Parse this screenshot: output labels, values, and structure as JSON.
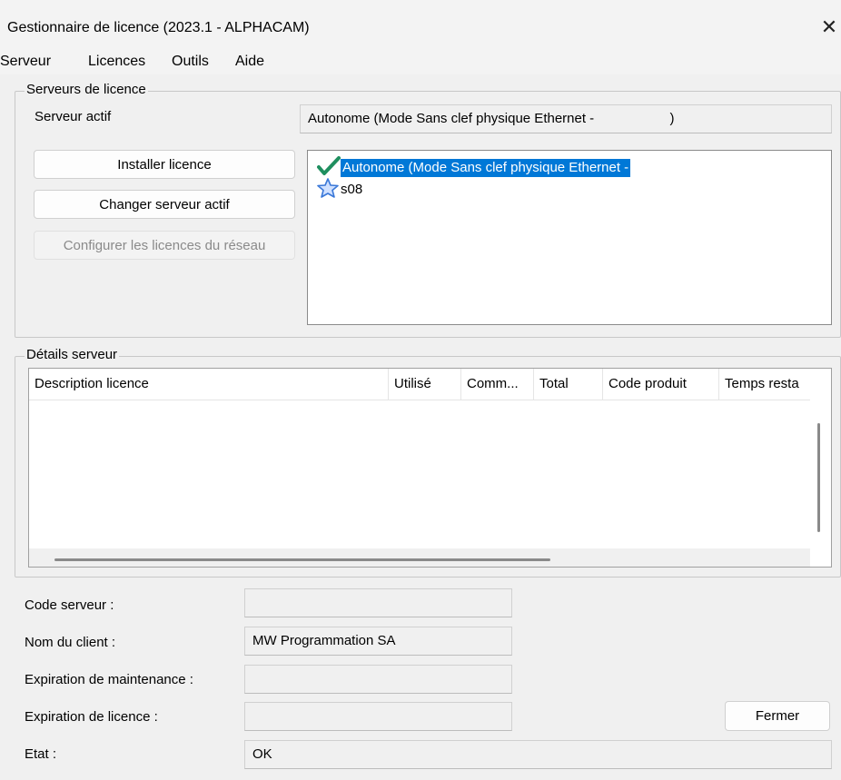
{
  "window": {
    "title": "Gestionnaire de licence (2023.1 - ALPHACAM)",
    "close_glyph": "✕"
  },
  "menu": [
    "Serveur",
    "Licences",
    "Outils",
    "Aide"
  ],
  "license_servers": {
    "group_title": "Serveurs de licence",
    "active_server_label": "Serveur actif",
    "active_server_value": "Autonome (Mode Sans clef physique Ethernet -                    )",
    "buttons": {
      "install": "Installer licence",
      "change_active": "Changer serveur actif",
      "configure_network": "Configurer les licences du réseau"
    },
    "list": [
      {
        "label": "Autonome (Mode Sans clef physique Ethernet -",
        "icon": "checkmark-icon",
        "selected": true
      },
      {
        "label": "s08",
        "icon": "star-icon",
        "selected": false
      }
    ]
  },
  "server_details": {
    "group_title": "Détails serveur",
    "columns": [
      "Description licence",
      "Utilisé",
      "Comm...",
      "Total",
      "Code produit",
      "Temps resta"
    ],
    "rows": []
  },
  "fields": {
    "server_code": {
      "label": "Code serveur :",
      "value": ""
    },
    "client_name": {
      "label": "Nom du client :",
      "value": "MW Programmation SA"
    },
    "maintenance_expiry": {
      "label": "Expiration de maintenance :",
      "value": ""
    },
    "license_expiry": {
      "label": "Expiration de licence :",
      "value": ""
    },
    "state": {
      "label": "Etat :",
      "value": "OK"
    }
  },
  "close_button": "Fermer",
  "colors": {
    "selection": "#0078d7",
    "check_green": "#1f8f5f",
    "star_blue": "#3a78d8"
  }
}
